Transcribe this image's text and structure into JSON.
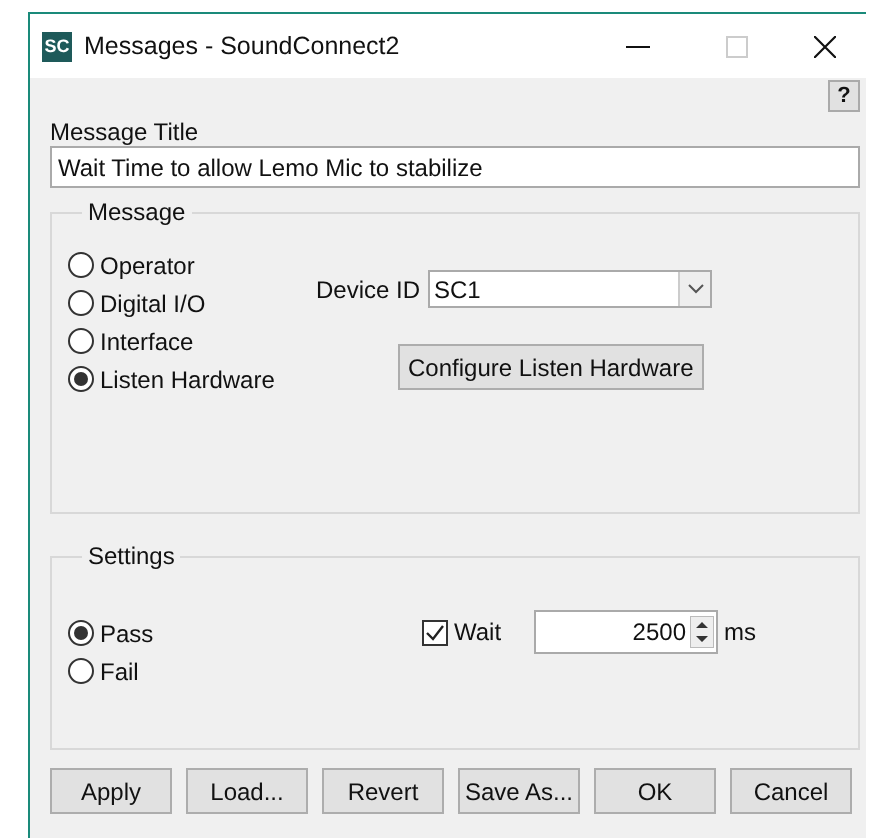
{
  "window": {
    "title": "Messages  - SoundConnect2",
    "logo": "SC"
  },
  "help_button": "?",
  "message_title": {
    "label": "Message Title",
    "value": "Wait Time to allow Lemo Mic to stabilize"
  },
  "message_group": {
    "title": "Message",
    "types": [
      {
        "label": "Operator",
        "selected": false
      },
      {
        "label": "Digital I/O",
        "selected": false
      },
      {
        "label": "Interface",
        "selected": false
      },
      {
        "label": "Listen Hardware",
        "selected": true
      }
    ],
    "device_id": {
      "label": "Device ID",
      "value": "SC1"
    },
    "configure_button": "Configure Listen Hardware"
  },
  "settings_group": {
    "title": "Settings",
    "results": [
      {
        "label": "Pass",
        "selected": true
      },
      {
        "label": "Fail",
        "selected": false
      }
    ],
    "wait": {
      "label": "Wait",
      "checked": true,
      "value": "2500",
      "unit": "ms"
    }
  },
  "buttons": [
    "Apply",
    "Load...",
    "Revert",
    "Save As...",
    "OK",
    "Cancel"
  ]
}
